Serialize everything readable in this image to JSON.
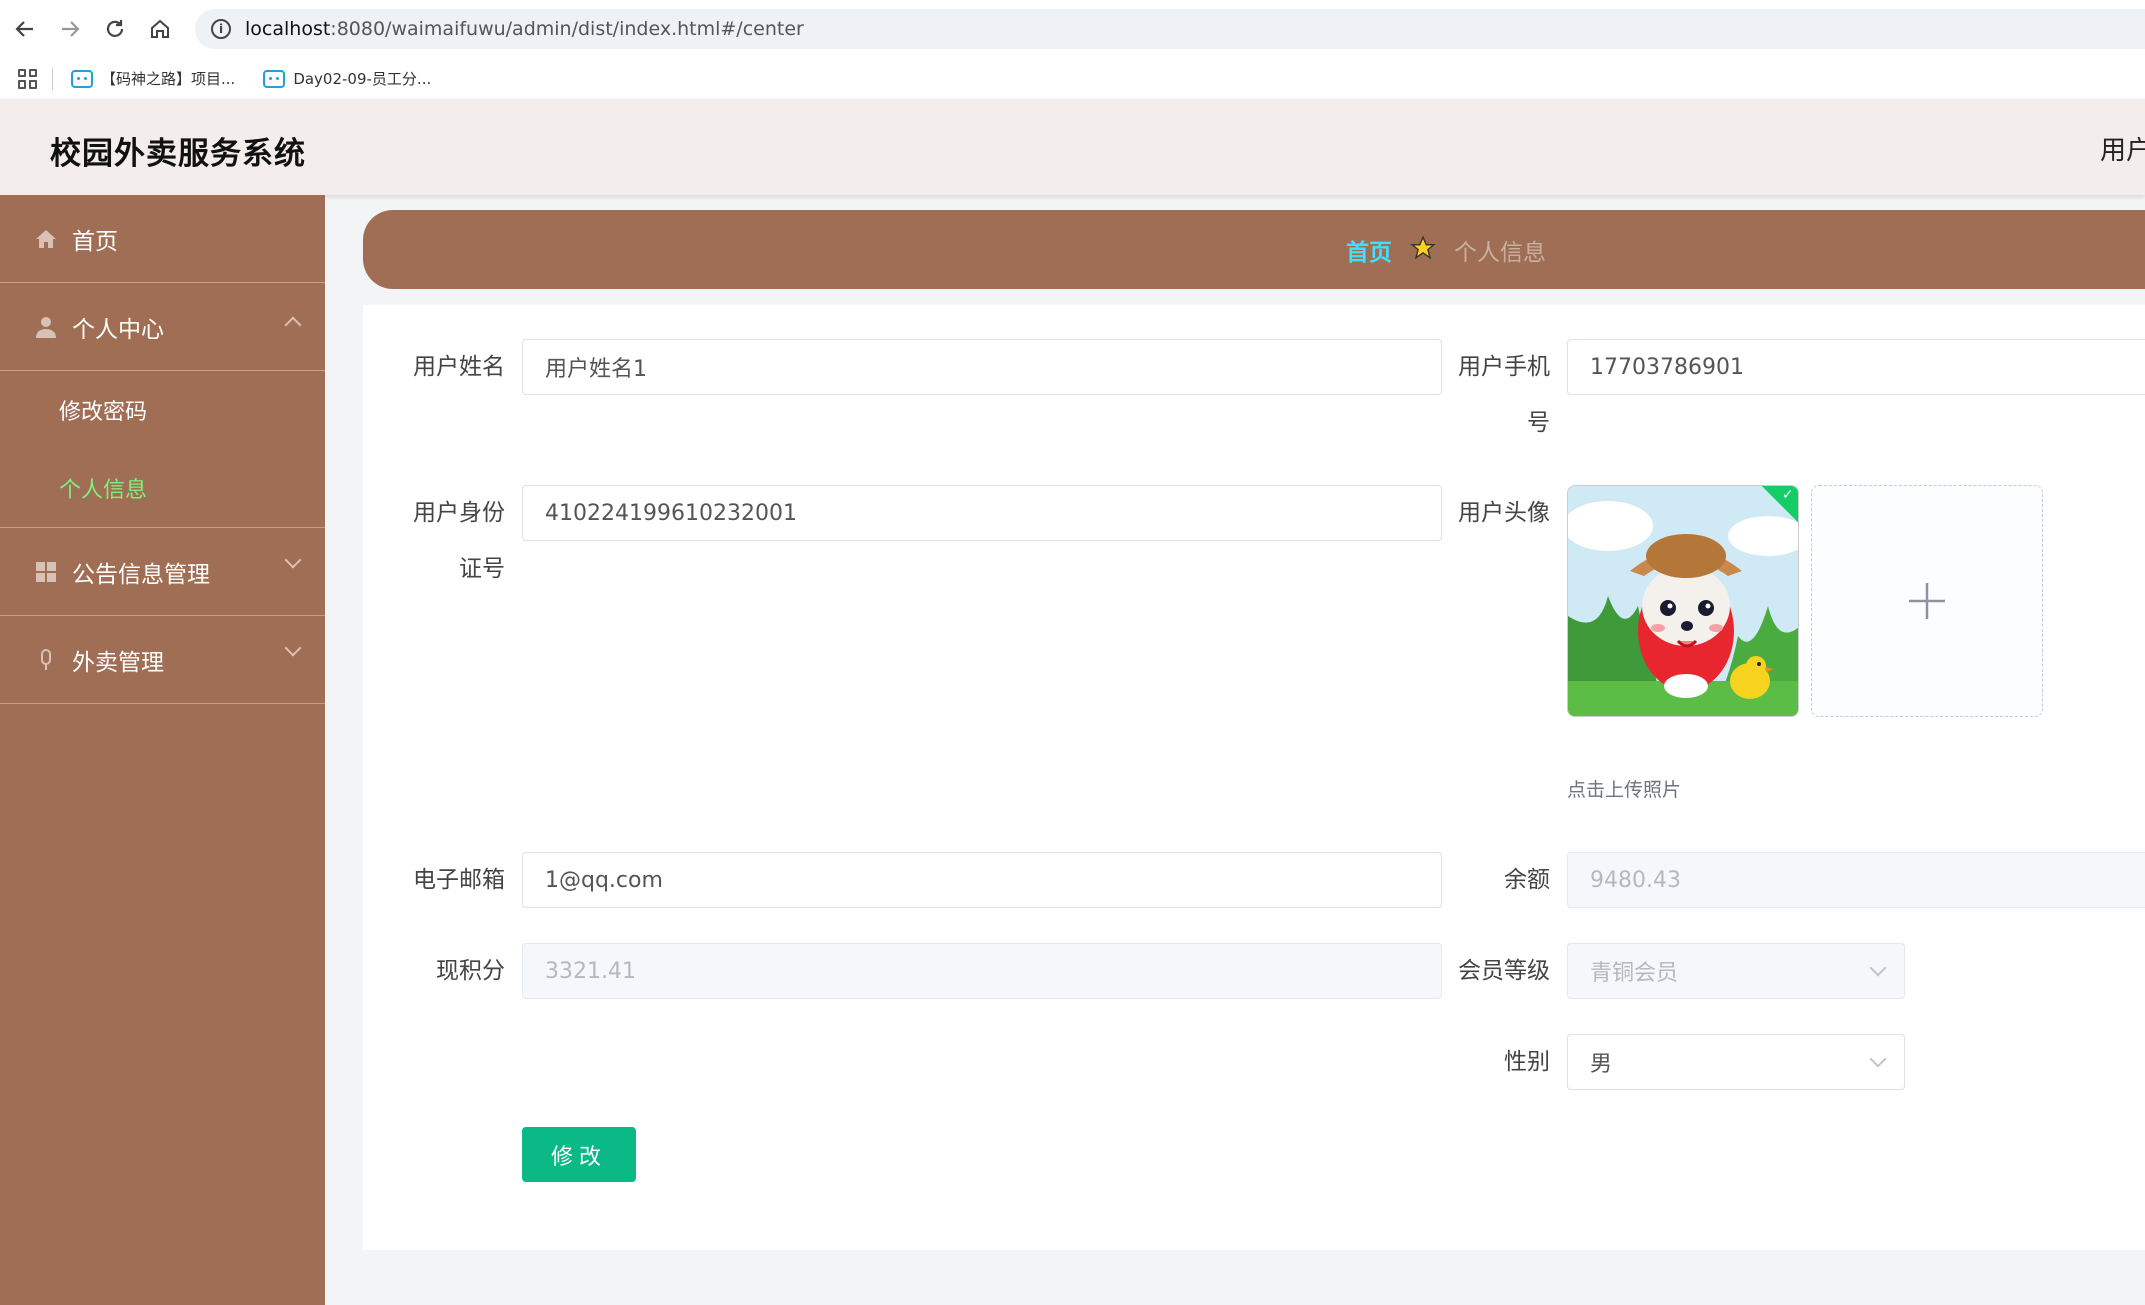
{
  "browser": {
    "url_host": "localhost",
    "url_path": ":8080/waimaifuwu/admin/dist/index.html#/center",
    "bookmarks": [
      {
        "label": "【码神之路】项目..."
      },
      {
        "label": "Day02-09-员工分..."
      }
    ]
  },
  "header": {
    "title": "校园外卖服务系统",
    "user": "用户"
  },
  "sidebar": {
    "items": [
      {
        "label": "首页",
        "icon": "home-icon"
      },
      {
        "label": "个人中心",
        "icon": "user-icon",
        "expanded": true,
        "children": [
          {
            "label": "修改密码"
          },
          {
            "label": "个人信息",
            "active": true
          }
        ]
      },
      {
        "label": "公告信息管理",
        "icon": "grid-icon"
      },
      {
        "label": "外卖管理",
        "icon": "mic-icon"
      }
    ]
  },
  "breadcrumb": {
    "home": "首页",
    "current": "个人信息"
  },
  "form": {
    "username_label": "用户姓名",
    "username_value": "用户姓名1",
    "phone_label_line1": "用户手机",
    "phone_label_line2": "号",
    "phone_value": "17703786901",
    "idcard_label_line1": "用户身份",
    "idcard_label_line2": "证号",
    "idcard_value": "410224199610232001",
    "avatar_label": "用户头像",
    "upload_hint": "点击上传照片",
    "email_label": "电子邮箱",
    "email_value": "1@qq.com",
    "balance_label": "余额",
    "balance_value": "9480.43",
    "points_label": "现积分",
    "points_value": "3321.41",
    "level_label": "会员等级",
    "level_value": "青铜会员",
    "gender_label": "性别",
    "gender_value": "男",
    "submit_label": "修改"
  },
  "colors": {
    "sidebar_bg": "#a06e54",
    "active_menu": "#7cf07c",
    "breadcrumb_home": "#40e0ff",
    "submit_bg": "#0bb987"
  }
}
